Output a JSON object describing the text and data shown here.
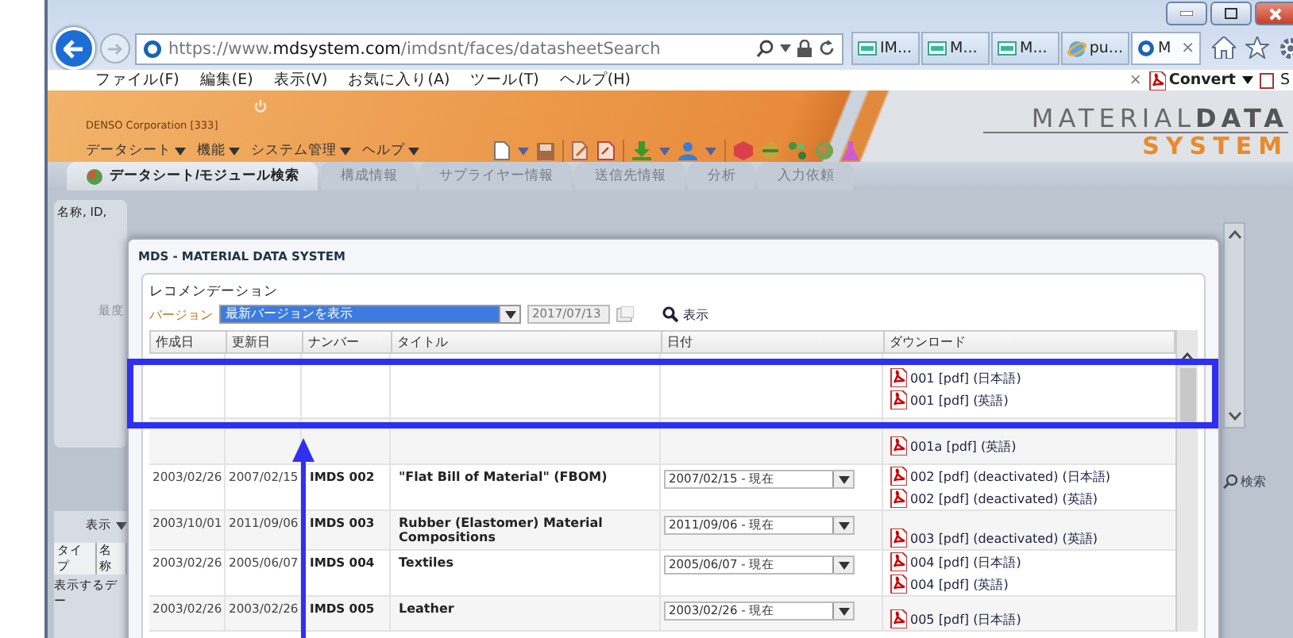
{
  "browser": {
    "address": "https://www.**mdsystem.com**/imdsnt/faces/datasheetSearch",
    "tabs": [
      {
        "label": "IM...",
        "kind": "page",
        "selected": false
      },
      {
        "label": "M...",
        "kind": "page",
        "selected": false
      },
      {
        "label": "M...",
        "kind": "page",
        "selected": false
      },
      {
        "label": "pu...",
        "kind": "browser",
        "selected": false
      },
      {
        "label": "M",
        "kind": "site",
        "selected": true,
        "close": "×"
      }
    ],
    "menu": [
      "ファイル(F)",
      "編集(E)",
      "表示(V)",
      "お気に入り(A)",
      "ツール(T)",
      "ヘルプ(H)"
    ],
    "command_bar": {
      "close": "×",
      "convert": "Convert",
      "cut_item": "S"
    }
  },
  "app": {
    "company": "DENSO Corporation [333]",
    "menus": [
      "データシート",
      "機能",
      "システム管理",
      "ヘルプ"
    ],
    "logo": {
      "line1": "MATERIAL**DATA**",
      "line2": "SYSTEM"
    },
    "tabs": [
      {
        "label": "データシート/モジュール検索",
        "selected": true,
        "disabled": false
      },
      {
        "label": "構成情報",
        "selected": false,
        "disabled": true
      },
      {
        "label": "サプライヤー情報",
        "selected": false,
        "disabled": true
      },
      {
        "label": "送信先情報",
        "selected": false,
        "disabled": true
      },
      {
        "label": "分析",
        "selected": false,
        "disabled": true
      },
      {
        "label": "入力依頼",
        "selected": false,
        "disabled": true
      }
    ]
  },
  "background": {
    "search_label": "名称, ID,",
    "field_label": "最度",
    "view_menu": "表示",
    "list_columns": [
      "タイプ",
      "名称"
    ],
    "empty_text": "表示するデー",
    "search_button": "検索"
  },
  "dialog": {
    "title": "MDS - MATERIAL DATA SYSTEM",
    "panel_title": "レコメンデーション",
    "version_label": "バージョン",
    "version_value": "最新バージョンを表示",
    "date_value": "2017/07/13",
    "show_button": "表示",
    "columns": [
      "作成日",
      "更新日",
      "ナンバー",
      "タイトル",
      "日付",
      "ダウンロード"
    ],
    "rows": [
      {
        "downloads": [
          "001 [pdf] (日本語)",
          "001 [pdf] (英語)"
        ]
      },
      {
        "downloads": [
          "001a [pdf] (英語)"
        ]
      },
      {
        "created": "2003/02/26",
        "updated": "2007/02/15",
        "number": "IMDS 002",
        "title": "\"Flat Bill of Material\" (FBOM)",
        "date": "2007/02/15 - 現在",
        "downloads": [
          "002 [pdf] (deactivated) (日本語)",
          "002 [pdf] (deactivated) (英語)"
        ]
      },
      {
        "created": "2003/10/01",
        "updated": "2011/09/06",
        "number": "IMDS 003",
        "title": "Rubber (Elastomer) Material Compositions",
        "date": "2011/09/06 - 現在",
        "downloads": [
          "003 [pdf] (deactivated) (英語)"
        ]
      },
      {
        "created": "2003/02/26",
        "updated": "2005/06/07",
        "number": "IMDS 004",
        "title": "Textiles",
        "date": "2005/06/07 - 現在",
        "downloads": [
          "004 [pdf] (日本語)",
          "004 [pdf] (英語)"
        ]
      },
      {
        "created": "2003/02/26",
        "updated": "2003/02/26",
        "number": "IMDS 005",
        "title": "Leather",
        "date": "2003/02/26 - 現在",
        "downloads": [
          "005 [pdf] (日本語)"
        ]
      }
    ]
  }
}
